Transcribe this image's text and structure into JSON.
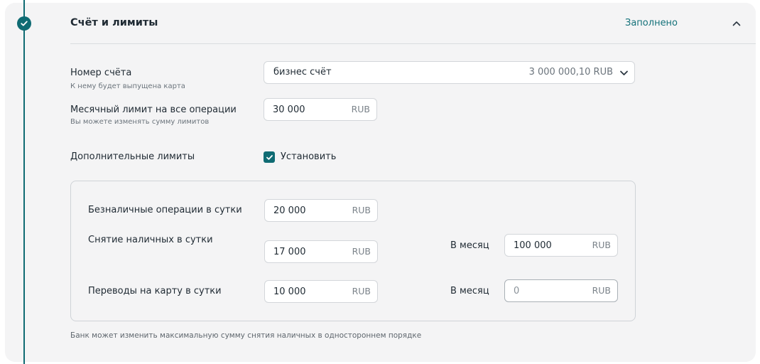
{
  "section": {
    "title": "Счёт и лимиты",
    "status": "Заполнено"
  },
  "account": {
    "label": "Номер счёта",
    "hint": "К нему будет выпущена карта",
    "selected_value": "бизнес счёт",
    "balance": "3 000 000,10 RUB"
  },
  "monthly_limit": {
    "label": "Месячный лимит на все операции",
    "hint": "Вы можете изменять сумму лимитов",
    "value": "30 000",
    "currency": "RUB"
  },
  "additional_limits": {
    "label": "Дополнительные лимиты",
    "checkbox_label": "Установить",
    "checked": true,
    "rows": [
      {
        "label": "Безналичные операции в сутки",
        "daily_value": "20 000",
        "currency": "RUB"
      },
      {
        "label": "Снятие наличных в сутки",
        "daily_value": "17 000",
        "currency": "RUB",
        "monthly_label": "В месяц",
        "monthly_value": "100 000"
      },
      {
        "label": "Переводы на карту в сутки",
        "daily_value": "10 000",
        "currency": "RUB",
        "monthly_label": "В месяц",
        "monthly_placeholder": "0"
      }
    ]
  },
  "footnote": "Банк может изменить максимальную сумму снятия наличных в одностороннем порядке",
  "colors": {
    "accent": "#0f6b73",
    "card_background": "#f4f4f5",
    "status_text": "#15727a"
  },
  "icons": {
    "step": "check-circle-icon",
    "collapse": "chevron-up-icon",
    "select": "chevron-down-icon",
    "checkbox": "checkmark-icon"
  }
}
